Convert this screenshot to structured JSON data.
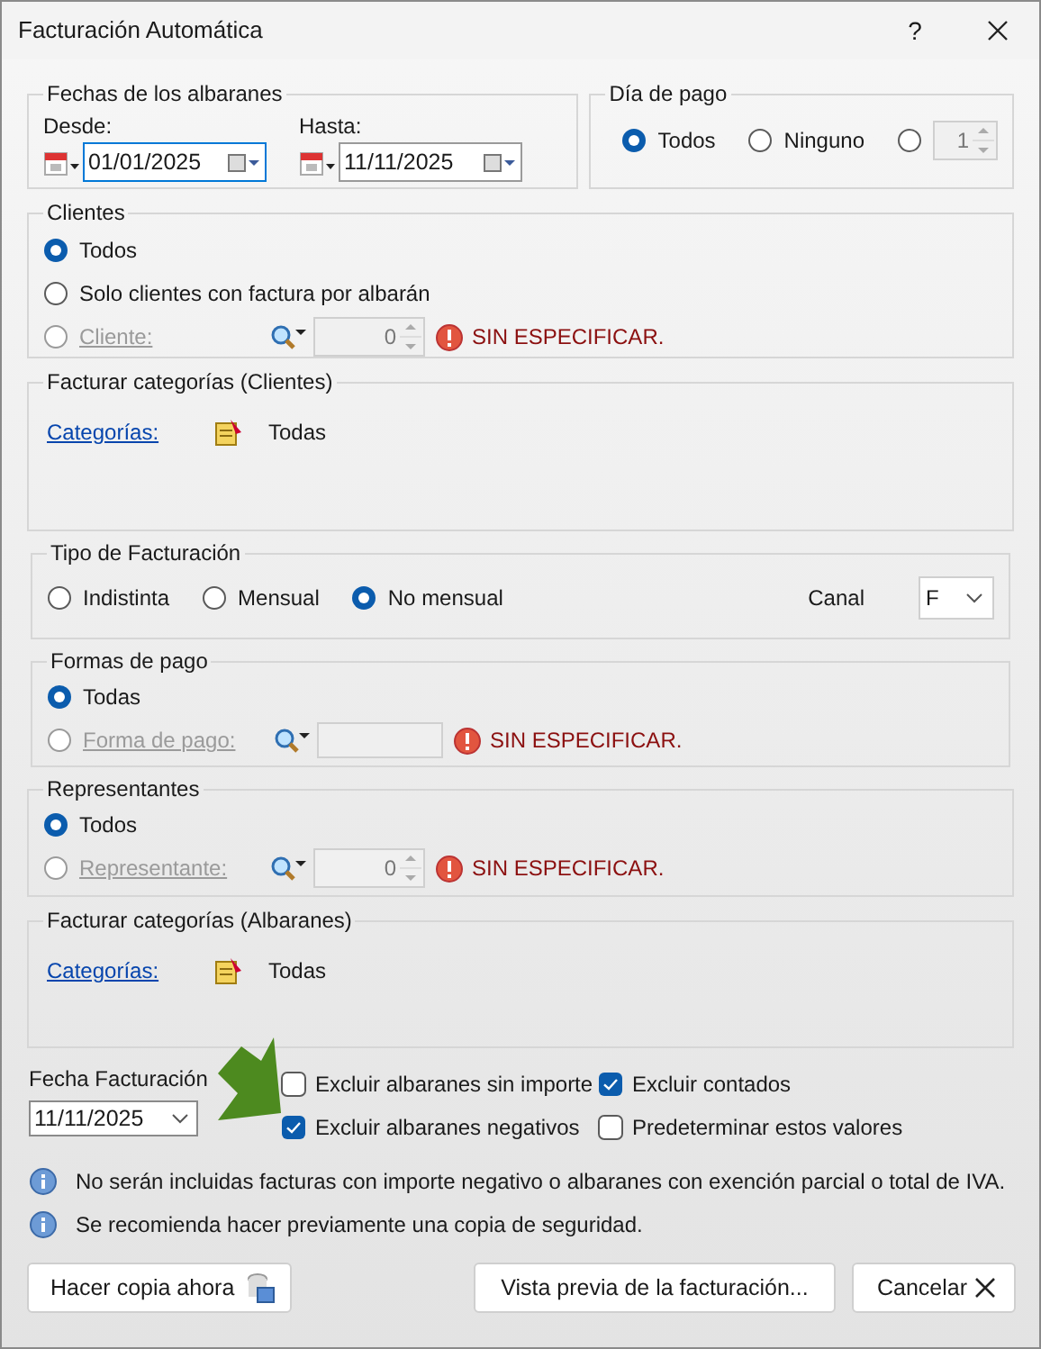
{
  "window": {
    "title": "Facturación Automática",
    "help": "?"
  },
  "fechas_albaranes": {
    "title": "Fechas de los albaranes",
    "fields": [
      {
        "label": "Desde:",
        "value": "01/01/2025",
        "focused": true
      },
      {
        "label": "Hasta:",
        "value": "11/11/2025",
        "focused": false
      }
    ]
  },
  "dia_pago": {
    "title": "Día de pago",
    "options": [
      {
        "kind": "plain",
        "label": "Todos",
        "selected": true
      },
      {
        "kind": "plain",
        "label": "Ninguno",
        "selected": false
      },
      {
        "kind": "spinner",
        "value": "1",
        "selected": false
      }
    ]
  },
  "clientes": {
    "title": "Clientes",
    "options": [
      {
        "kind": "plain",
        "label": "Todos",
        "selected": true
      },
      {
        "kind": "plain",
        "label": "Solo clientes con factura por albarán",
        "selected": false
      },
      {
        "kind": "lookup",
        "label": "Cliente:",
        "value": "0",
        "status": "SIN ESPECIFICAR.",
        "selected": false,
        "disabled": true
      }
    ]
  },
  "categorias_clientes": {
    "title": "Facturar categorías (Clientes)",
    "link": "Categorías:",
    "value": "Todas"
  },
  "tipo_facturacion": {
    "title": "Tipo de Facturación",
    "options": [
      {
        "label": "Indistinta",
        "selected": false
      },
      {
        "label": "Mensual",
        "selected": false
      },
      {
        "label": "No mensual",
        "selected": true
      }
    ],
    "canal": {
      "label": "Canal",
      "value": "F"
    }
  },
  "formas_pago": {
    "title": "Formas de pago",
    "options": [
      {
        "kind": "plain",
        "label": "Todas",
        "selected": true
      },
      {
        "kind": "lookup",
        "label": "Forma de pago:",
        "status": "SIN ESPECIFICAR.",
        "selected": false,
        "disabled": true
      }
    ]
  },
  "representantes": {
    "title": "Representantes",
    "options": [
      {
        "kind": "plain",
        "label": "Todos",
        "selected": true
      },
      {
        "kind": "lookup",
        "label": "Representante:",
        "value": "0",
        "status": "SIN ESPECIFICAR.",
        "selected": false,
        "disabled": true
      }
    ]
  },
  "categorias_albaranes": {
    "title": "Facturar categorías (Albaranes)",
    "link": "Categorías:",
    "value": "Todas"
  },
  "fecha_facturacion": {
    "label": "Fecha Facturación",
    "value": "11/11/2025"
  },
  "checkboxes": [
    {
      "label": "Excluir albaranes sin importe",
      "checked": false
    },
    {
      "label": "Excluir contados",
      "checked": true
    },
    {
      "label": "Excluir albaranes negativos",
      "checked": true
    },
    {
      "label": "Predeterminar estos valores",
      "checked": false
    }
  ],
  "notes": [
    "No serán incluidas facturas con importe negativo o albaranes con exención parcial o total de IVA.",
    "Se recomienda hacer previamente una copia de seguridad."
  ],
  "buttons": [
    {
      "kind": "backup",
      "label": "Hacer copia ahora"
    },
    {
      "kind": "preview",
      "label": "Vista previa de la facturación..."
    },
    {
      "kind": "cancel",
      "label": "Cancelar"
    }
  ]
}
